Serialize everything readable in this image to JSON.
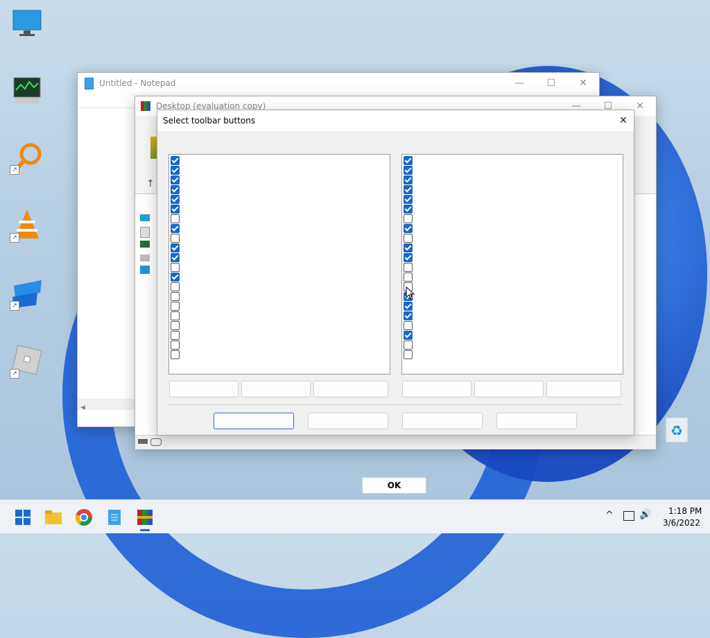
{
  "notepad": {
    "title": "Untitled - Notepad"
  },
  "winrar": {
    "title": "Desktop (evaluation copy)"
  },
  "dialog": {
    "title": "Select toolbar buttons",
    "left_checks": [
      true,
      true,
      true,
      true,
      true,
      true,
      false,
      true,
      false,
      true,
      true,
      false,
      true,
      false,
      false,
      false,
      false,
      false,
      false,
      false,
      false
    ],
    "right_checks": [
      true,
      true,
      true,
      true,
      true,
      true,
      false,
      true,
      false,
      true,
      true,
      false,
      false,
      false,
      true,
      true,
      true,
      false,
      true,
      false,
      false
    ],
    "left_buttons": [
      "",
      "",
      ""
    ],
    "right_buttons": [
      "",
      "",
      ""
    ],
    "bottom_buttons": [
      "",
      "",
      "",
      ""
    ]
  },
  "ok_button": "OK",
  "caption": {
    "minimize": "—",
    "maximize": "☐",
    "close": "✕"
  },
  "clock": {
    "time": "1:18 PM",
    "date": "3/6/2022"
  },
  "tray": {
    "chevron": "^",
    "volume": "🔊"
  },
  "colors": {
    "accent": "#1a67c9",
    "desktop": "#b7cfe3"
  }
}
